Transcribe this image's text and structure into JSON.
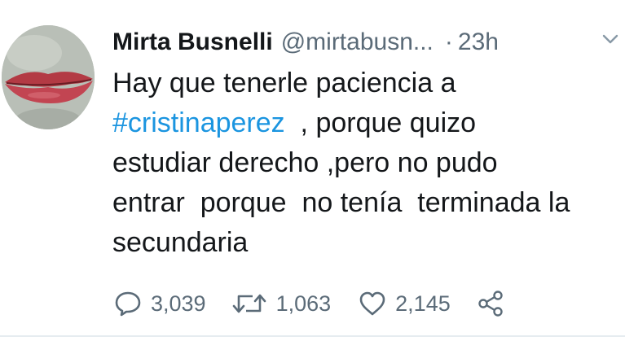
{
  "tweet": {
    "author_name": "Mirta Busnelli",
    "handle": "@mirtabusn...",
    "separator": "·",
    "time": "23h",
    "text_lines": [
      {
        "text": "Hay que tenerle paciencia a"
      },
      {
        "hashtag": "#cristinaperez",
        "rest": "  , porque quizo"
      },
      {
        "text": "estudiar derecho ,pero no pudo"
      },
      {
        "text": "entrar  porque  no tenía  terminada la"
      },
      {
        "text": "secundaria"
      }
    ],
    "actions": {
      "reply_count": "3,039",
      "retweet_count": "1,063",
      "like_count": "2,145"
    }
  },
  "colors": {
    "hashtag": "#1b95e0",
    "muted": "#5b6b78",
    "text": "#14171a"
  },
  "icons": [
    "avatar-image",
    "chevron-down-icon",
    "reply-icon",
    "retweet-icon",
    "like-icon",
    "share-icon"
  ]
}
